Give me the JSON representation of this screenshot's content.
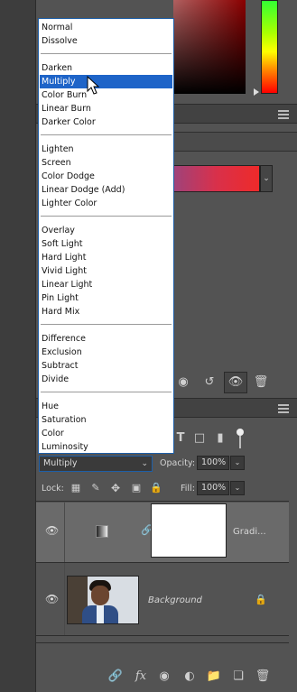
{
  "blend_menu": {
    "groups": [
      [
        "Normal",
        "Dissolve"
      ],
      [
        "Darken",
        "Multiply",
        "Color Burn",
        "Linear Burn",
        "Darker Color"
      ],
      [
        "Lighten",
        "Screen",
        "Color Dodge",
        "Linear Dodge (Add)",
        "Lighter Color"
      ],
      [
        "Overlay",
        "Soft Light",
        "Hard Light",
        "Vivid Light",
        "Linear Light",
        "Pin Light",
        "Hard Mix"
      ],
      [
        "Difference",
        "Exclusion",
        "Subtract",
        "Divide"
      ],
      [
        "Hue",
        "Saturation",
        "Color",
        "Luminosity"
      ]
    ],
    "selected": "Multiply"
  },
  "layers": {
    "blend_mode": "Multiply",
    "opacity_label": "Opacity:",
    "opacity_value": "100%",
    "lock_label": "Lock:",
    "fill_label": "Fill:",
    "fill_value": "100%",
    "items": [
      {
        "name": "Gradi...",
        "selected": true
      },
      {
        "name": "Background",
        "selected": false
      }
    ]
  },
  "colors": {
    "accent": "#1e64c8",
    "panel_bg": "#535353",
    "selected_layer": "#6a6a6a"
  }
}
